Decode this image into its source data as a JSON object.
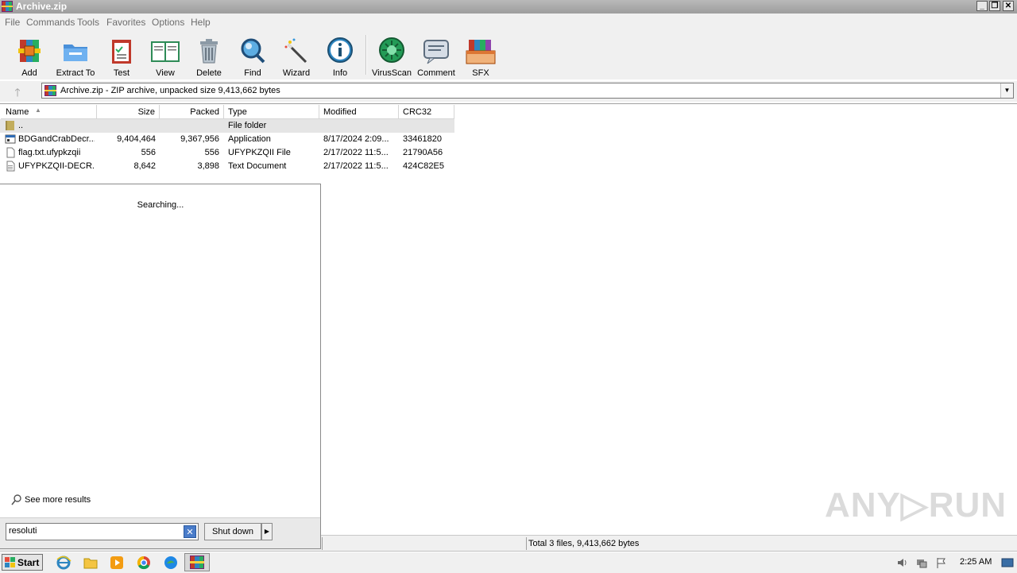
{
  "window": {
    "title": "Archive.zip",
    "controls": {
      "minimize": "_",
      "restore": "❐",
      "close": "✕"
    }
  },
  "menu": [
    "File",
    "Commands",
    "Tools",
    "Favorites",
    "Options",
    "Help"
  ],
  "toolbar": [
    {
      "label": "Add",
      "icon": "add-archive-icon"
    },
    {
      "label": "Extract To",
      "icon": "extract-folder-icon"
    },
    {
      "label": "Test",
      "icon": "test-clipboard-icon"
    },
    {
      "label": "View",
      "icon": "view-book-icon"
    },
    {
      "label": "Delete",
      "icon": "trash-icon"
    },
    {
      "label": "Find",
      "icon": "magnifier-icon"
    },
    {
      "label": "Wizard",
      "icon": "wand-icon"
    },
    {
      "label": "Info",
      "icon": "info-icon"
    },
    {
      "label": "VirusScan",
      "icon": "virus-icon"
    },
    {
      "label": "Comment",
      "icon": "comment-icon"
    },
    {
      "label": "SFX",
      "icon": "sfx-box-icon"
    }
  ],
  "address": {
    "text": "Archive.zip - ZIP archive, unpacked size 9,413,662 bytes",
    "up_glyph": "🡑"
  },
  "columns": {
    "name": "Name",
    "size": "Size",
    "packed": "Packed",
    "type": "Type",
    "modified": "Modified",
    "crc": "CRC32"
  },
  "files": [
    {
      "name": "..",
      "size": "",
      "packed": "",
      "type": "File folder",
      "modified": "",
      "crc": ""
    },
    {
      "name": "BDGandCrabDecr...",
      "size": "9,404,464",
      "packed": "9,367,956",
      "type": "Application",
      "modified": "8/17/2024 2:09...",
      "crc": "33461820"
    },
    {
      "name": "flag.txt.ufypkzqii",
      "size": "556",
      "packed": "556",
      "type": "UFYPKZQII File",
      "modified": "2/17/2022 11:5...",
      "crc": "21790A56"
    },
    {
      "name": "UFYPKZQII-DECR...",
      "size": "8,642",
      "packed": "3,898",
      "type": "Text Document",
      "modified": "2/17/2022 11:5...",
      "crc": "424C82E5"
    }
  ],
  "status": {
    "summary": "Total 3 files, 9,413,662 bytes"
  },
  "start_menu": {
    "searching": "Searching...",
    "see_more": "See more results",
    "search_value": "resoluti",
    "shutdown": "Shut down",
    "clear_glyph": "✕",
    "arrow_glyph": "▶"
  },
  "taskbar": {
    "start": "Start",
    "clock": "2:25 AM",
    "apps": [
      "internet-explorer-icon",
      "file-explorer-icon",
      "media-player-icon",
      "chrome-icon",
      "edge-icon",
      "winrar-icon"
    ]
  },
  "watermark": "ANY▷RUN"
}
